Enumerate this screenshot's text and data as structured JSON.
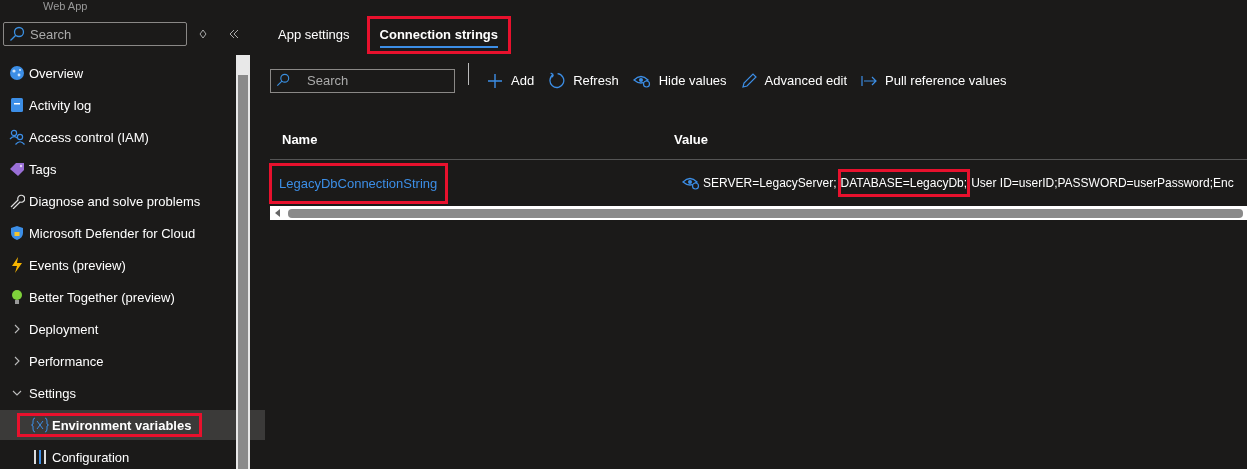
{
  "header": {
    "subtitle": "Web App"
  },
  "sidebar": {
    "search": {
      "placeholder": "Search"
    },
    "items": [
      {
        "label": "Overview",
        "kind": "link",
        "selected": false,
        "highlighted": false
      },
      {
        "label": "Activity log",
        "kind": "link",
        "selected": false,
        "highlighted": false
      },
      {
        "label": "Access control (IAM)",
        "kind": "link",
        "selected": false,
        "highlighted": false
      },
      {
        "label": "Tags",
        "kind": "link",
        "selected": false,
        "highlighted": false
      },
      {
        "label": "Diagnose and solve problems",
        "kind": "link",
        "selected": false,
        "highlighted": false
      },
      {
        "label": "Microsoft Defender for Cloud",
        "kind": "link",
        "selected": false,
        "highlighted": false
      },
      {
        "label": "Events (preview)",
        "kind": "link",
        "selected": false,
        "highlighted": false
      },
      {
        "label": "Better Together (preview)",
        "kind": "link",
        "selected": false,
        "highlighted": false
      },
      {
        "label": "Deployment",
        "kind": "group",
        "expanded": false
      },
      {
        "label": "Performance",
        "kind": "group",
        "expanded": false
      },
      {
        "label": "Settings",
        "kind": "group",
        "expanded": true,
        "children": [
          {
            "label": "Environment variables",
            "kind": "link",
            "selected": true,
            "highlighted": true
          },
          {
            "label": "Configuration",
            "kind": "link",
            "selected": false,
            "highlighted": false
          }
        ]
      }
    ]
  },
  "tabs": [
    {
      "label": "App settings",
      "selected": false,
      "highlighted": false
    },
    {
      "label": "Connection strings",
      "selected": true,
      "highlighted": true
    }
  ],
  "toolbar": {
    "search": {
      "placeholder": "Search"
    },
    "buttons": [
      "Add",
      "Refresh",
      "Hide values",
      "Advanced edit",
      "Pull reference values"
    ]
  },
  "table": {
    "columns": [
      "Name",
      "Value"
    ],
    "rows": [
      {
        "name": "LegacyDbConnectionString",
        "name_highlighted": true,
        "value_parts": [
          {
            "text": "SERVER=LegacyServer;",
            "highlighted": false
          },
          {
            "text": "DATABASE=LegacyDb;",
            "highlighted": true
          },
          {
            "text": "User ID=userID;PASSWORD=userPassword;Enc",
            "highlighted": false
          }
        ]
      }
    ]
  }
}
